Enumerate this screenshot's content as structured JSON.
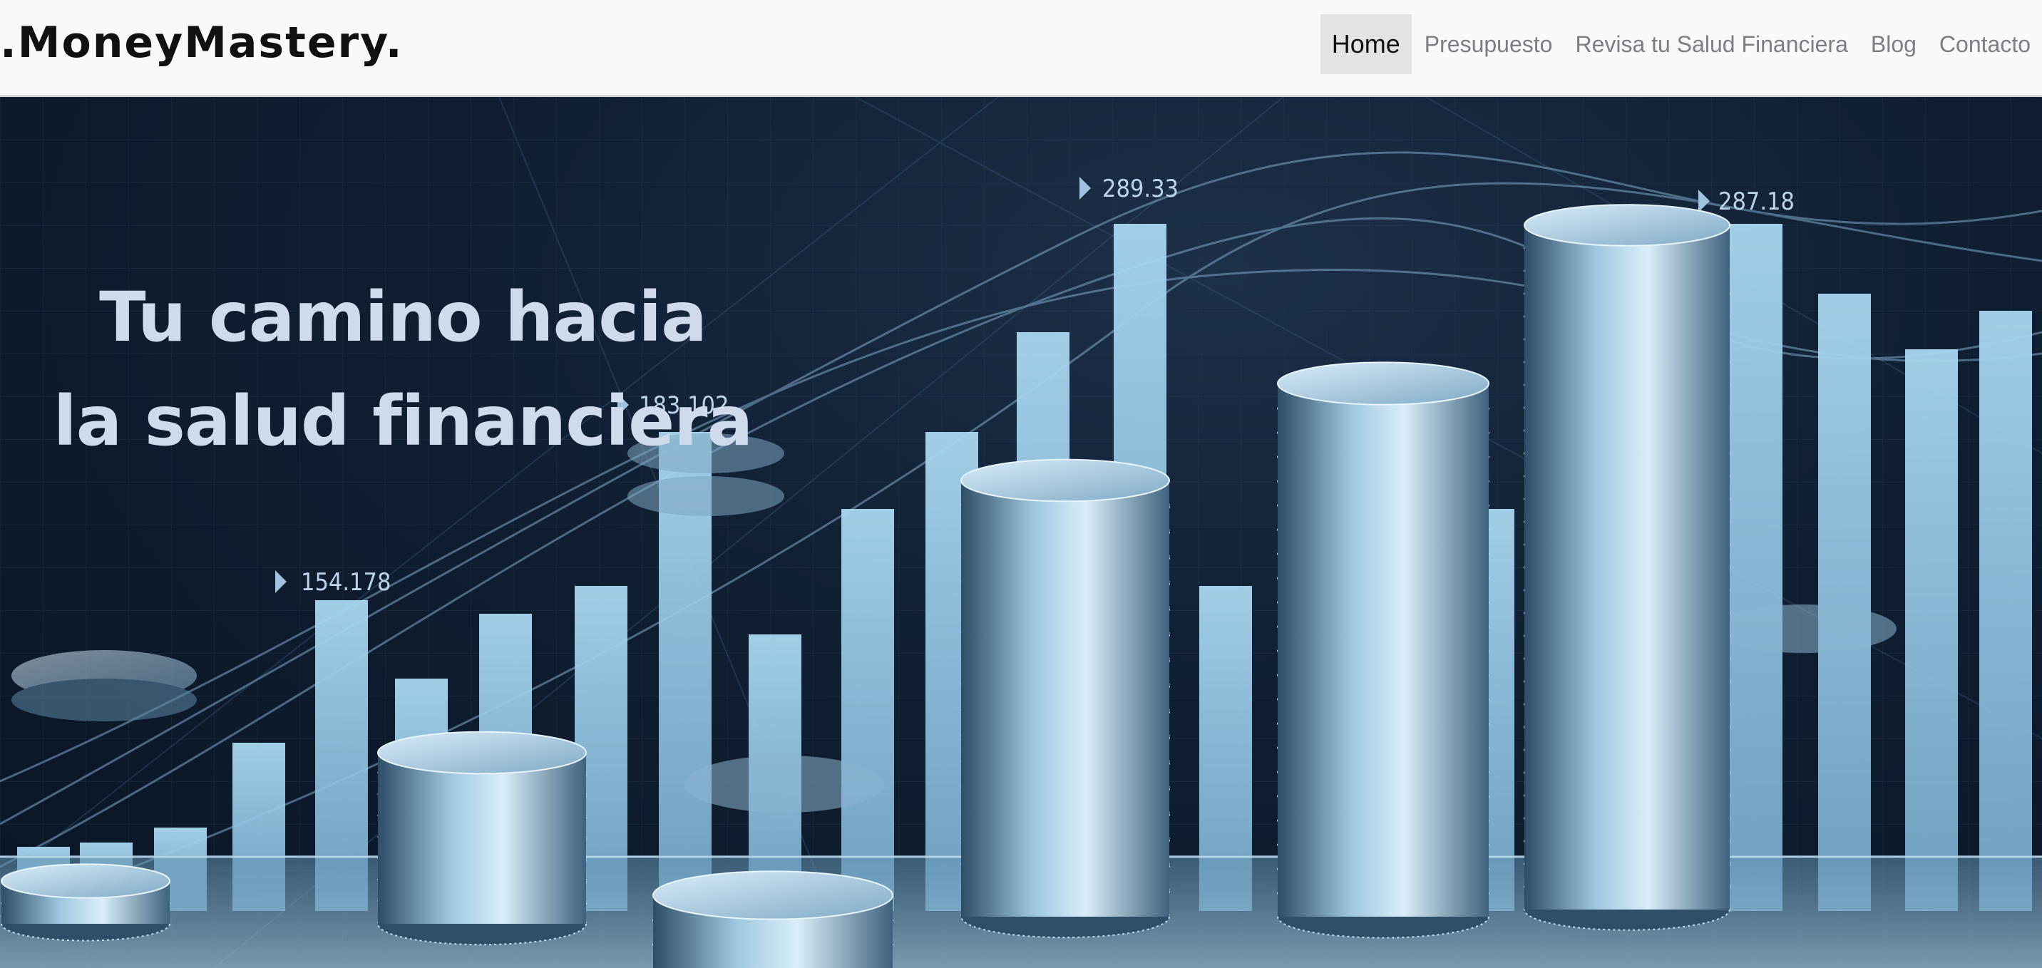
{
  "brand": {
    "name": ".MoneyMastery."
  },
  "nav": {
    "items": [
      {
        "label": "Home",
        "active": true
      },
      {
        "label": "Presupuesto",
        "active": false
      },
      {
        "label": "Revisa tu Salud Financiera",
        "active": false
      },
      {
        "label": "Blog",
        "active": false
      },
      {
        "label": "Contacto",
        "active": false
      }
    ]
  },
  "hero": {
    "title_line1": "Tu camino hacia",
    "title_line2": "la salud financiera",
    "image_labels": [
      "154.178",
      "183.102",
      "289.33",
      "287.18"
    ]
  },
  "colors": {
    "navbar_bg": "#f8f9fa",
    "active_tab_bg": "#e2e3e5",
    "hero_text": "#cfdaec",
    "bar_fill": "#8fc3e2"
  }
}
